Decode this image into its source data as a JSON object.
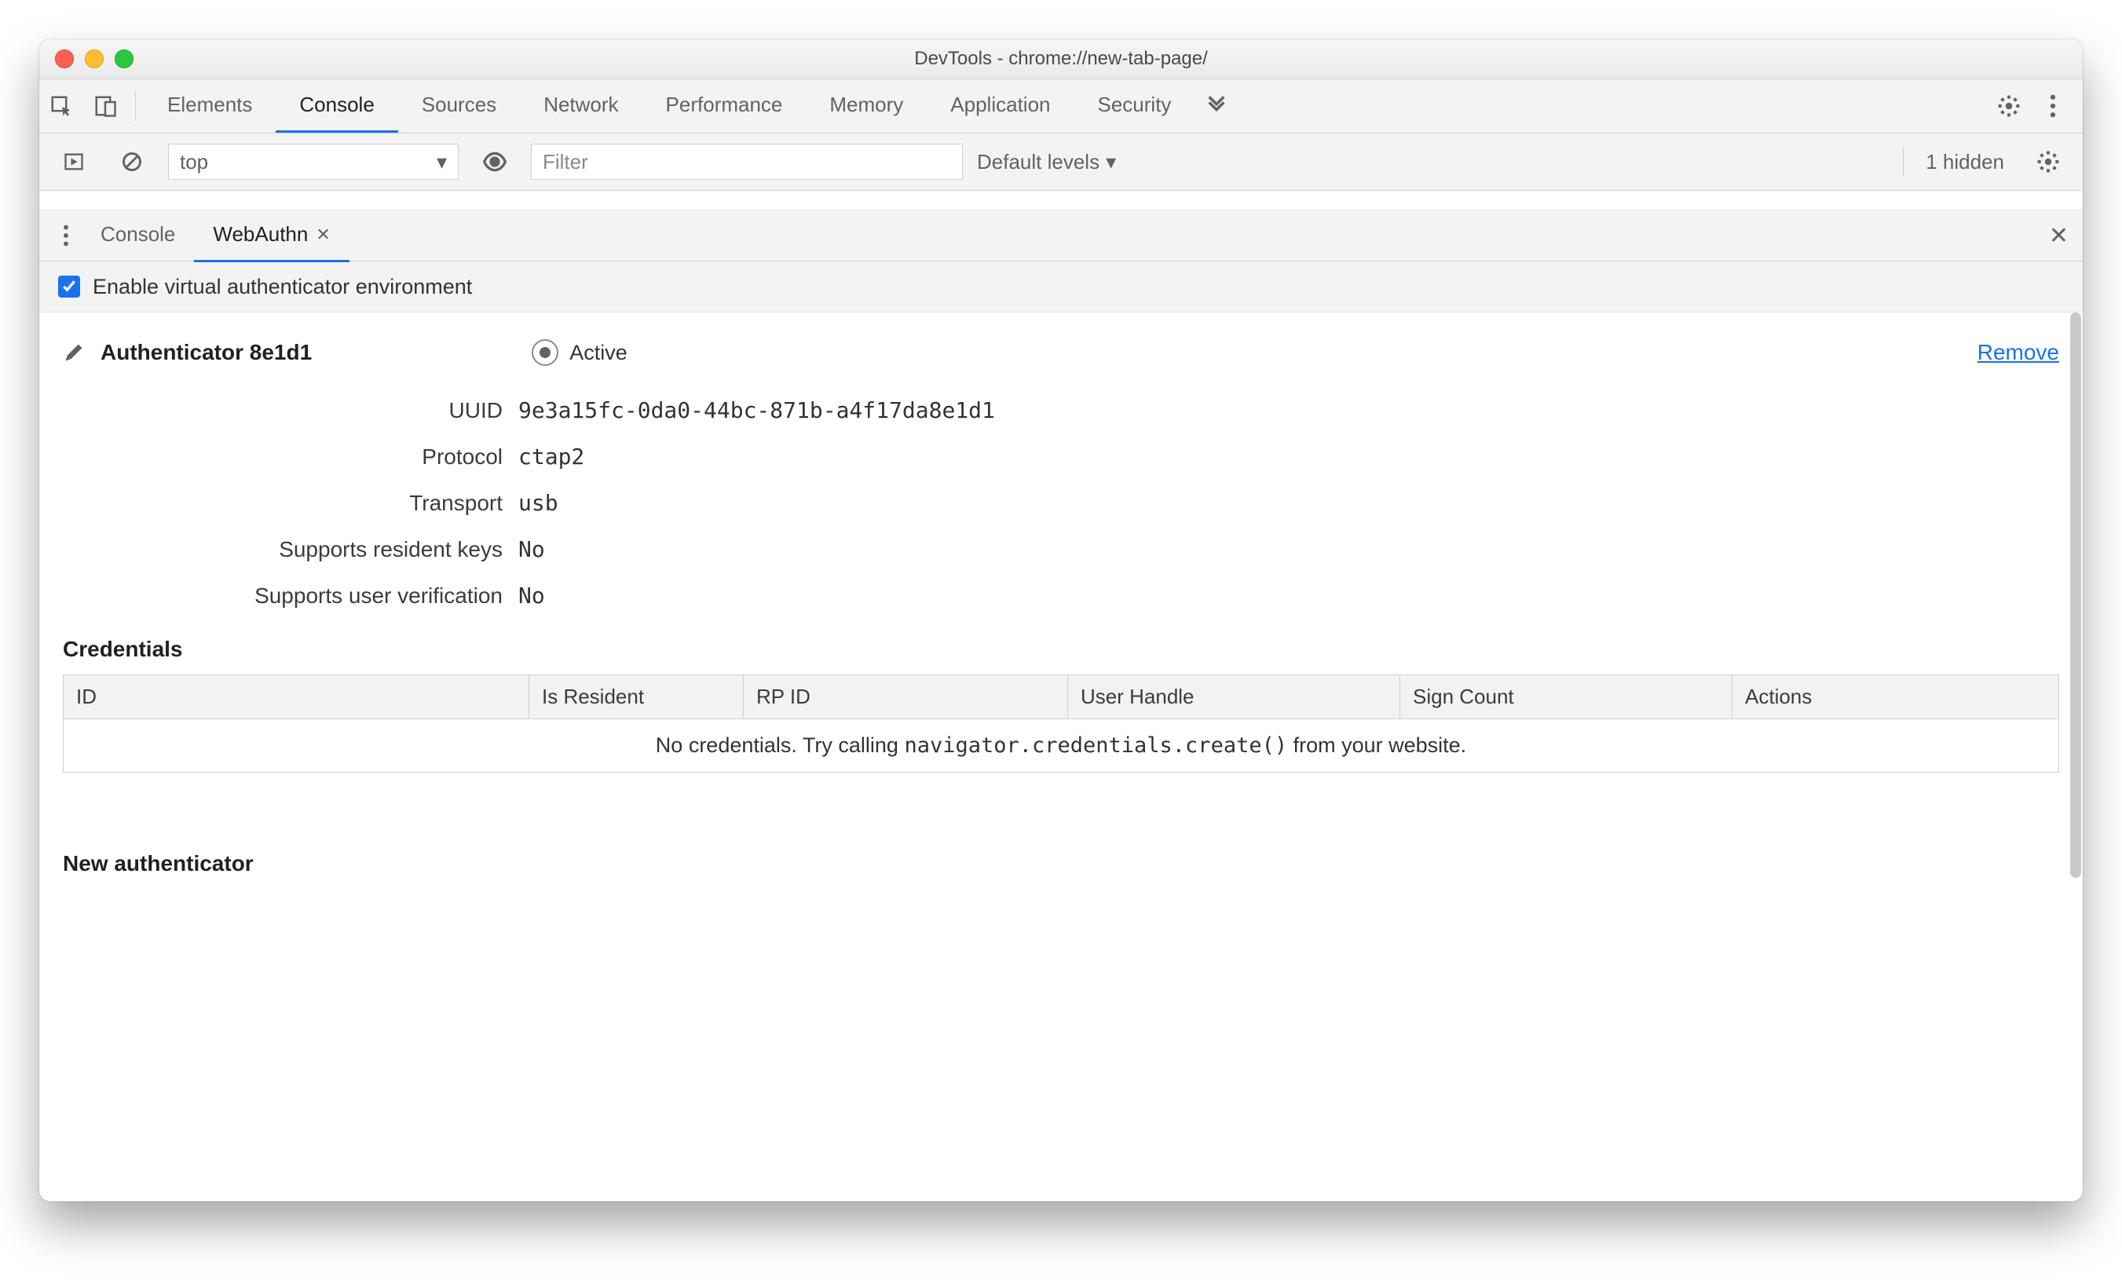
{
  "window": {
    "title": "DevTools - chrome://new-tab-page/"
  },
  "main_tabs": {
    "items": [
      {
        "label": "Elements"
      },
      {
        "label": "Console"
      },
      {
        "label": "Sources"
      },
      {
        "label": "Network"
      },
      {
        "label": "Performance"
      },
      {
        "label": "Memory"
      },
      {
        "label": "Application"
      },
      {
        "label": "Security"
      }
    ],
    "active_index": 1
  },
  "console_toolbar": {
    "context": "top",
    "filter_placeholder": "Filter",
    "levels_label": "Default levels",
    "hidden_text": "1 hidden"
  },
  "drawer": {
    "tabs": [
      {
        "label": "Console"
      },
      {
        "label": "WebAuthn"
      }
    ],
    "active_index": 1
  },
  "webauthn": {
    "enable_label": "Enable virtual authenticator environment",
    "authenticator": {
      "title_prefix": "Authenticator",
      "short_id": "8e1d1",
      "active_label": "Active",
      "remove_label": "Remove",
      "props": {
        "uuid_label": "UUID",
        "uuid": "9e3a15fc-0da0-44bc-871b-a4f17da8e1d1",
        "protocol_label": "Protocol",
        "protocol": "ctap2",
        "transport_label": "Transport",
        "transport": "usb",
        "resident_label": "Supports resident keys",
        "resident": "No",
        "userver_label": "Supports user verification",
        "userver": "No"
      }
    },
    "credentials": {
      "heading": "Credentials",
      "columns": {
        "id": "ID",
        "is_resident": "Is Resident",
        "rp_id": "RP ID",
        "user_handle": "User Handle",
        "sign_count": "Sign Count",
        "actions": "Actions"
      },
      "empty_pre": "No credentials. Try calling ",
      "empty_code": "navigator.credentials.create()",
      "empty_post": " from your website."
    },
    "new_auth_heading": "New authenticator"
  }
}
